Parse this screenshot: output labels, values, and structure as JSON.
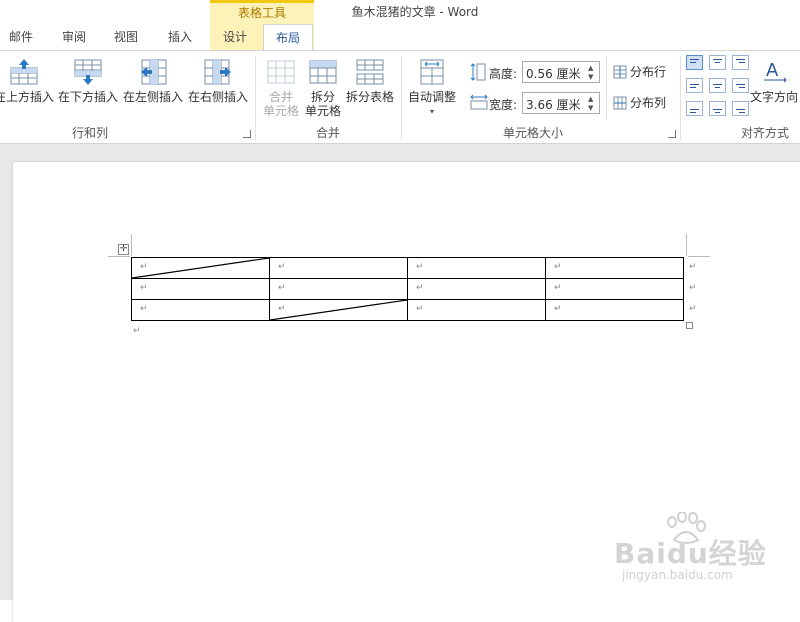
{
  "window": {
    "context_tool": "表格工具",
    "title": "鱼木混猪的文章 - Word"
  },
  "tabs": [
    {
      "label": "邮件"
    },
    {
      "label": "审阅"
    },
    {
      "label": "视图"
    },
    {
      "label": "插入"
    },
    {
      "label": "设计"
    },
    {
      "label": "布局"
    }
  ],
  "ribbon": {
    "rows_cols": {
      "group_label": "行和列",
      "insert_above": "在上方插入",
      "insert_below": "在下方插入",
      "insert_left": "在左侧插入",
      "insert_right": "在右侧插入"
    },
    "merge": {
      "group_label": "合并",
      "merge_cells_1": "合并",
      "merge_cells_2": "单元格",
      "split_cells_1": "拆分",
      "split_cells_2": "单元格",
      "split_table": "拆分表格"
    },
    "cell_size": {
      "group_label": "单元格大小",
      "autofit": "自动调整",
      "height_label": "高度:",
      "height_value": "0.56 厘米",
      "width_label": "宽度:",
      "width_value": "3.66 厘米",
      "distribute_rows": "分布行",
      "distribute_cols": "分布列"
    },
    "alignment": {
      "group_label": "对齐方式",
      "text_direction": "文字方向"
    }
  },
  "document": {
    "paragraph_mark": "↵",
    "table": {
      "rows": 3,
      "cols": 4,
      "diagonal_cells": [
        "r1c1",
        "r3c2"
      ]
    }
  },
  "watermark": {
    "brand": "Baidu经验",
    "url": "jingyan.baidu.com"
  },
  "colors": {
    "accent": "#2b579a",
    "context_tab": "#fdf2b8",
    "context_border": "#f2c811"
  }
}
